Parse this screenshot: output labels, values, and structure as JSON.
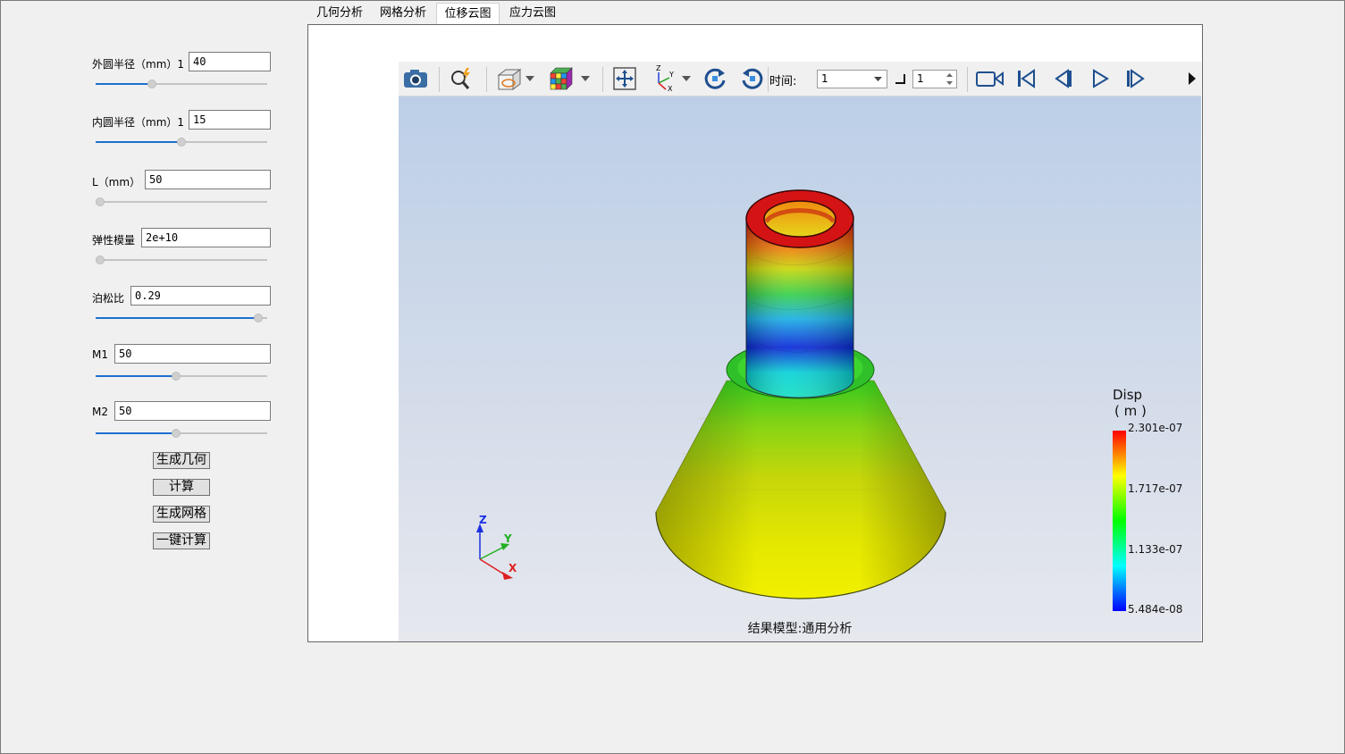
{
  "tabs": [
    {
      "label": "几何分析"
    },
    {
      "label": "网格分析"
    },
    {
      "label": "位移云图",
      "active": true
    },
    {
      "label": "应力云图"
    }
  ],
  "params": {
    "outer_radius": {
      "label": "外圆半径（mm）1",
      "value": "40",
      "slider_fraction": 0.33
    },
    "inner_radius": {
      "label": "内圆半径（mm）1",
      "value": "15",
      "slider_fraction": 0.5
    },
    "length": {
      "label": "L（mm）",
      "value": "50",
      "slider_fraction": 0.0
    },
    "elastic_modulus": {
      "label": "弹性模量",
      "value": "2e+10",
      "slider_fraction": 0.0
    },
    "poisson_ratio": {
      "label": "泊松比",
      "value": "0.29",
      "slider_fraction": 0.95
    },
    "m1": {
      "label": "M1",
      "value": "50",
      "slider_fraction": 0.47
    },
    "m2": {
      "label": "M2",
      "value": "50",
      "slider_fraction": 0.47
    }
  },
  "buttons": {
    "generate_geometry": "生成几何",
    "compute": "计算",
    "generate_mesh": "生成网格",
    "one_click_compute": "一键计算"
  },
  "toolbar": {
    "time_label": "时间:",
    "time_value": "1",
    "step_value": "1"
  },
  "viewport": {
    "legend": {
      "title": "Disp",
      "unit": "( m )",
      "max": "2.301e-07",
      "mid_high": "1.717e-07",
      "mid_low": "1.133e-07",
      "min": "5.484e-08",
      "colormap": [
        "#ff0000",
        "#ffff00",
        "#00ff00",
        "#00ffff",
        "#0000ff"
      ]
    },
    "axes": {
      "x": "X",
      "y": "Y",
      "z": "Z"
    },
    "caption": "结果模型:通用分析"
  },
  "colors": {
    "accent": "#1e6fd0",
    "axis_x": "#e02020",
    "axis_y": "#20b020",
    "axis_z": "#2040e0"
  },
  "icons": [
    "camera-icon",
    "query-icon",
    "view-cube-icon",
    "dropdown-arrow-icon",
    "colormap-cube-icon",
    "fit-view-icon",
    "axes-orientation-icon",
    "rotate-right-icon",
    "rotate-left-icon",
    "video-record-icon",
    "first-frame-icon",
    "previous-frame-icon",
    "play-icon",
    "last-frame-icon"
  ]
}
